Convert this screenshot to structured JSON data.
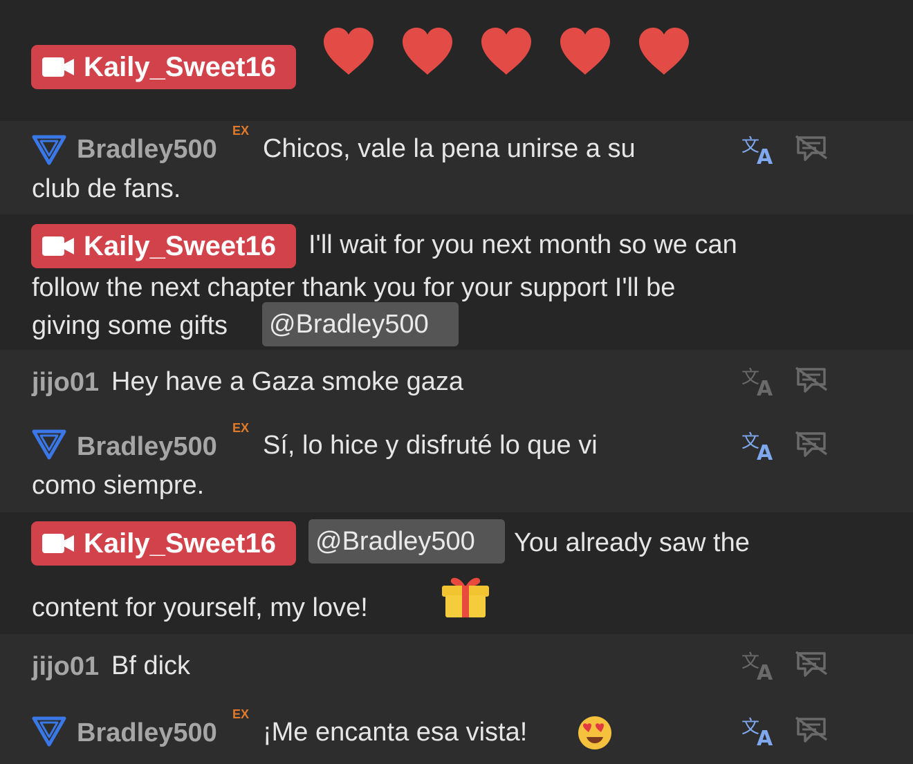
{
  "hearts_count": 5,
  "messages": [
    {
      "id": "m0",
      "user": "Kaily_Sweet16"
    },
    {
      "id": "m1",
      "user": "Bradley500",
      "badge": "EX",
      "line1": "Chicos, vale la pena unirse a su",
      "line2": "club de fans."
    },
    {
      "id": "m2",
      "user": "Kaily_Sweet16",
      "line1": "I'll wait for you next month so we can",
      "line2": "follow the next chapter thank you for your support I'll be",
      "line3": "giving some gifts",
      "mention": "@Bradley500"
    },
    {
      "id": "m3",
      "user": "jijo01",
      "line1": "Hey have a Gaza smoke gaza"
    },
    {
      "id": "m4",
      "user": "Bradley500",
      "badge": "EX",
      "line1": "Sí, lo hice y disfruté lo que vi",
      "line2": "como siempre."
    },
    {
      "id": "m5",
      "user": "Kaily_Sweet16",
      "mention": "@Bradley500",
      "line1": "You already saw the",
      "line2": "content for yourself, my love!"
    },
    {
      "id": "m6",
      "user": "jijo01",
      "line1": "Bf dick"
    },
    {
      "id": "m7",
      "user": "Bradley500",
      "badge": "EX",
      "line1": "¡Me encanta esa vista!"
    }
  ],
  "colors": {
    "broadcaster_badge": "#d2424a",
    "heart": "#e34b46",
    "ex_badge": "#e07a2a",
    "fan_icon": "#3a78e8",
    "translate_active": "#7fa8ef",
    "icon_muted": "#6a6a6a",
    "mention_bg": "#555555"
  },
  "icons": {
    "camera": "video-camera-icon",
    "heart": "heart-icon",
    "fan": "triangle-fan-icon",
    "translate": "translate-icon",
    "hide": "hide-message-icon",
    "gift": "gift-icon",
    "emoji": "heart-eyes-emoji-icon"
  }
}
